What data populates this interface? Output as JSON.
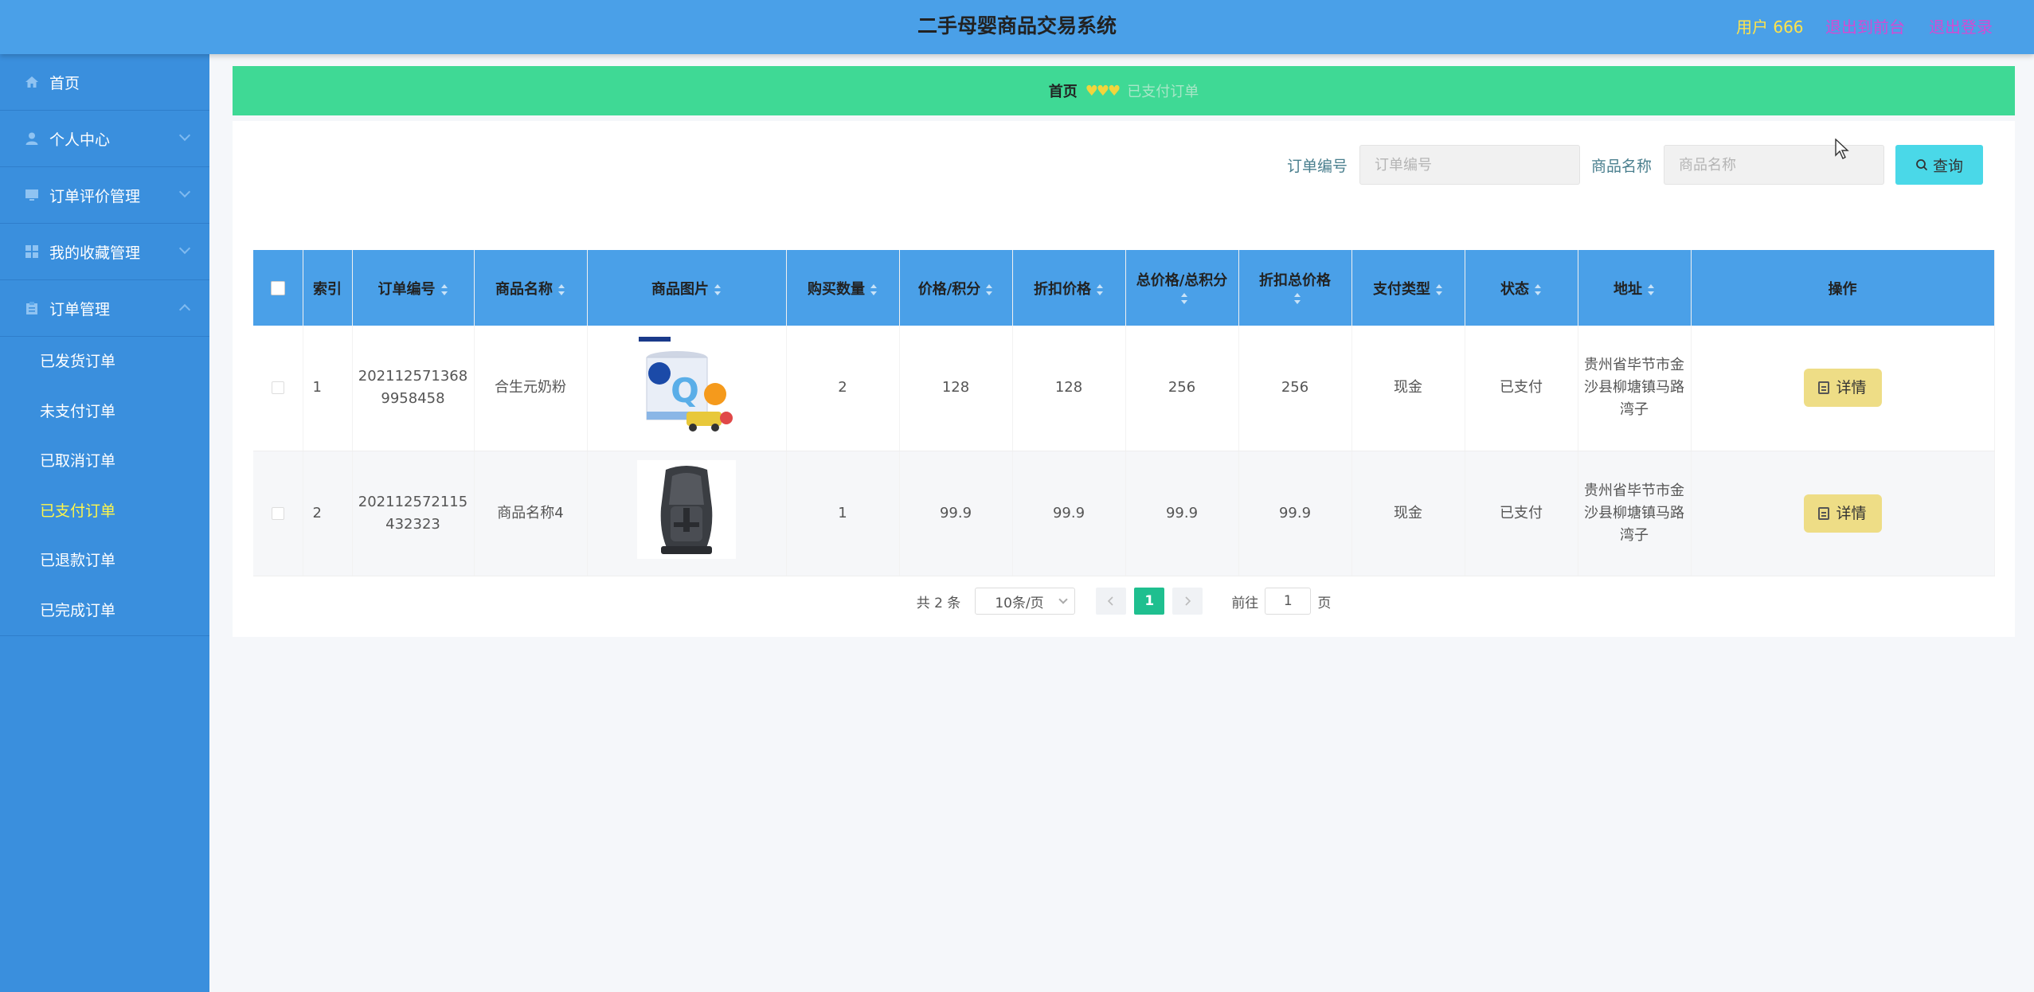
{
  "header": {
    "title": "二手母婴商品交易系统",
    "user": "用户 666",
    "to_front": "退出到前台",
    "logout": "退出登录"
  },
  "sidebar": {
    "items": [
      {
        "label": "首页",
        "icon": "home-icon"
      },
      {
        "label": "个人中心",
        "icon": "user-icon"
      },
      {
        "label": "订单评价管理",
        "icon": "monitor-icon"
      },
      {
        "label": "我的收藏管理",
        "icon": "grid-icon"
      },
      {
        "label": "订单管理",
        "icon": "clipboard-icon"
      }
    ],
    "sub_items": [
      "已发货订单",
      "未支付订单",
      "已取消订单",
      "已支付订单",
      "已退款订单",
      "已完成订单"
    ]
  },
  "breadcrumb": {
    "home": "首页",
    "sep": "♥♥♥",
    "current": "已支付订单"
  },
  "search": {
    "order_label": "订单编号",
    "order_placeholder": "订单编号",
    "name_label": "商品名称",
    "name_placeholder": "商品名称",
    "query_button": "查询"
  },
  "table": {
    "headers": [
      "索引",
      "订单编号",
      "商品名称",
      "商品图片",
      "购买数量",
      "价格/积分",
      "折扣价格",
      "总价格/总积分",
      "折扣总价格",
      "支付类型",
      "状态",
      "地址",
      "操作"
    ],
    "rows": [
      {
        "index": "1",
        "order_no": "2021125713689958458",
        "name": "合生元奶粉",
        "qty": "2",
        "price": "128",
        "discount": "128",
        "total": "256",
        "discount_total": "256",
        "pay_type": "现金",
        "status": "已支付",
        "address": "贵州省毕节市金沙县柳塘镇马路湾子",
        "action": "详情"
      },
      {
        "index": "2",
        "order_no": "202112572115432323",
        "name": "商品名称4",
        "qty": "1",
        "price": "99.9",
        "discount": "99.9",
        "total": "99.9",
        "discount_total": "99.9",
        "pay_type": "现金",
        "status": "已支付",
        "address": "贵州省毕节市金沙县柳塘镇马路湾子",
        "action": "详情"
      }
    ]
  },
  "pager": {
    "total": "共 2 条",
    "size": "10条/页",
    "current": "1",
    "goto": "前往",
    "goto_value": "1",
    "page_unit": "页"
  },
  "colors": {
    "header": "#4aa0e8",
    "sidebar": "#3a8fdd",
    "breadcrumb": "#3fd995",
    "active_sub": "#fff64a",
    "query_button": "#4ad8e8",
    "detail_button": "#eedd86",
    "pager_active": "#1fbf8f"
  }
}
